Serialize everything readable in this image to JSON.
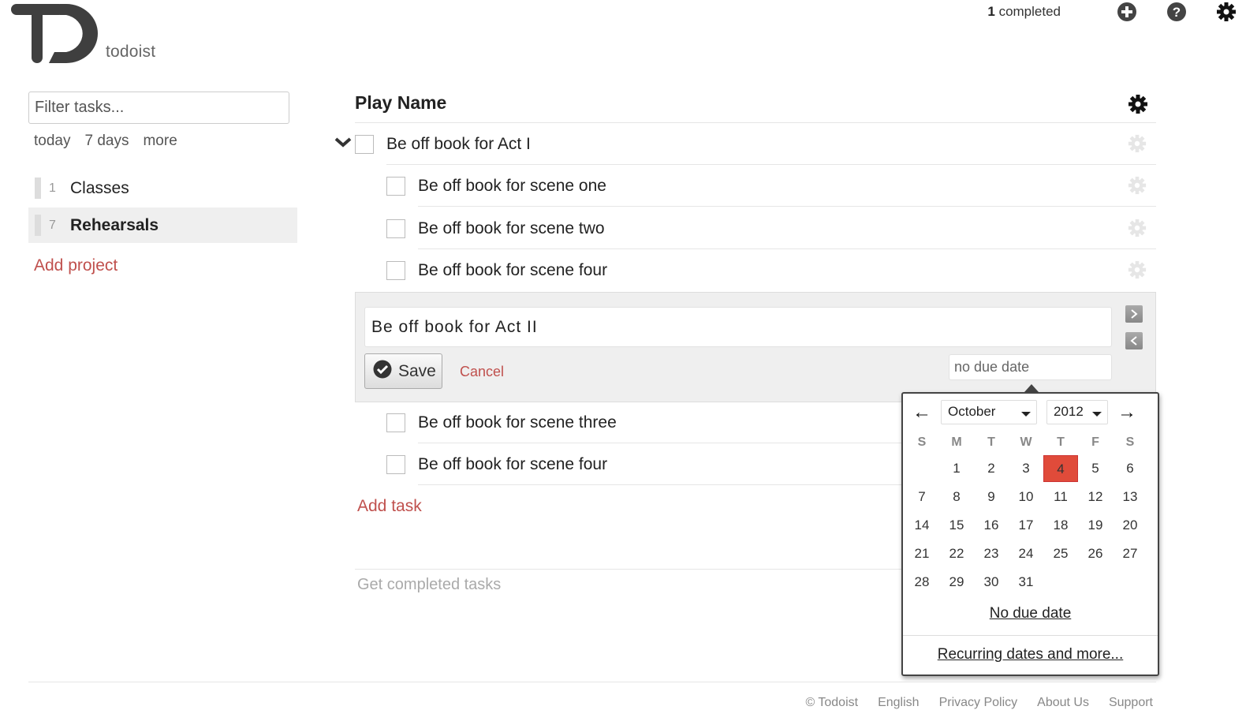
{
  "app": {
    "name": "todoist"
  },
  "topbar": {
    "completed_count": "1",
    "completed_label": "completed",
    "icons": [
      "add-icon",
      "help-icon",
      "settings-gear-icon"
    ]
  },
  "sidebar": {
    "filter_placeholder": "Filter tasks...",
    "quick_links": [
      "today",
      "7 days",
      "more"
    ],
    "projects": [
      {
        "count": "1",
        "name": "Classes",
        "active": false
      },
      {
        "count": "7",
        "name": "Rehearsals",
        "active": true
      }
    ],
    "add_project_label": "Add project"
  },
  "main": {
    "title": "Play Name",
    "tasks_above": [
      {
        "label": "Be off book for Act I",
        "level": 0,
        "collapsible": true
      },
      {
        "label": "Be off book for scene one",
        "level": 1
      },
      {
        "label": "Be off book for scene two",
        "level": 1
      },
      {
        "label": "Be off book for scene four",
        "level": 1
      }
    ],
    "editor": {
      "value": "Be off book for Act II",
      "save_label": "Save",
      "cancel_label": "Cancel",
      "due_placeholder": "no due date"
    },
    "tasks_below": [
      {
        "label": "Be off book for scene three",
        "level": 1
      },
      {
        "label": "Be off book for scene four",
        "level": 1
      }
    ],
    "add_task_label": "Add task",
    "get_completed_label": "Get completed tasks"
  },
  "datepicker": {
    "prev_arrow": "←",
    "next_arrow": "→",
    "month": "October",
    "year": "2012",
    "weekdays": [
      "S",
      "M",
      "T",
      "W",
      "T",
      "F",
      "S"
    ],
    "weeks": [
      [
        "",
        "1",
        "2",
        "3",
        "4",
        "5",
        "6"
      ],
      [
        "7",
        "8",
        "9",
        "10",
        "11",
        "12",
        "13"
      ],
      [
        "14",
        "15",
        "16",
        "17",
        "18",
        "19",
        "20"
      ],
      [
        "21",
        "22",
        "23",
        "24",
        "25",
        "26",
        "27"
      ],
      [
        "28",
        "29",
        "30",
        "31",
        "",
        "",
        ""
      ]
    ],
    "selected_day": "4",
    "selected_color": "#e04b3a",
    "no_due_date_label": "No due date",
    "recurring_label": "Recurring dates and more..."
  },
  "footer": {
    "links": [
      "© Todoist",
      "English",
      "Privacy Policy",
      "About Us",
      "Support"
    ]
  },
  "colors": {
    "accent_red": "#c0504d",
    "text_dark": "#222222",
    "muted": "#aaaaaa"
  }
}
